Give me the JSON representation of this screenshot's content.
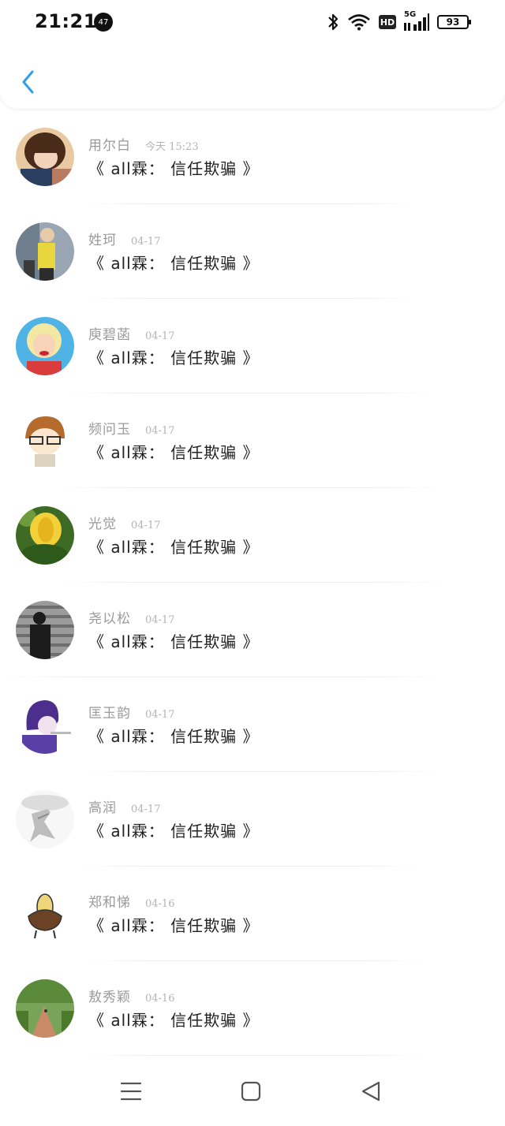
{
  "status": {
    "time": "21:21",
    "notification_count": "47",
    "network": "5G",
    "hd_label": "HD",
    "battery": "93"
  },
  "header": {
    "back_icon": "chevron-left-icon",
    "accent_color": "#2f9ee8"
  },
  "items": [
    {
      "name": "用尔白",
      "time": "今天 15:23",
      "title": "《 all霖： 信任欺骗 》"
    },
    {
      "name": "姓珂",
      "time": "04-17",
      "title": "《 all霖： 信任欺骗 》"
    },
    {
      "name": "庾碧菡",
      "time": "04-17",
      "title": "《 all霖： 信任欺骗 》"
    },
    {
      "name": "频问玉",
      "time": "04-17",
      "title": "《 all霖： 信任欺骗 》"
    },
    {
      "name": "光觉",
      "time": "04-17",
      "title": "《 all霖： 信任欺骗 》"
    },
    {
      "name": "尧以松",
      "time": "04-17",
      "title": "《 all霖： 信任欺骗 》"
    },
    {
      "name": "匡玉韵",
      "time": "04-17",
      "title": "《 all霖： 信任欺骗 》"
    },
    {
      "name": "高润",
      "time": "04-17",
      "title": "《 all霖： 信任欺骗 》"
    },
    {
      "name": "郑和悌",
      "time": "04-16",
      "title": "《 all霖： 信任欺骗 》"
    },
    {
      "name": "敖秀颖",
      "time": "04-16",
      "title": "《 all霖： 信任欺骗 》"
    }
  ],
  "nav": {
    "menu_icon": "menu-icon",
    "home_icon": "home-square-icon",
    "back_icon": "back-triangle-icon"
  }
}
